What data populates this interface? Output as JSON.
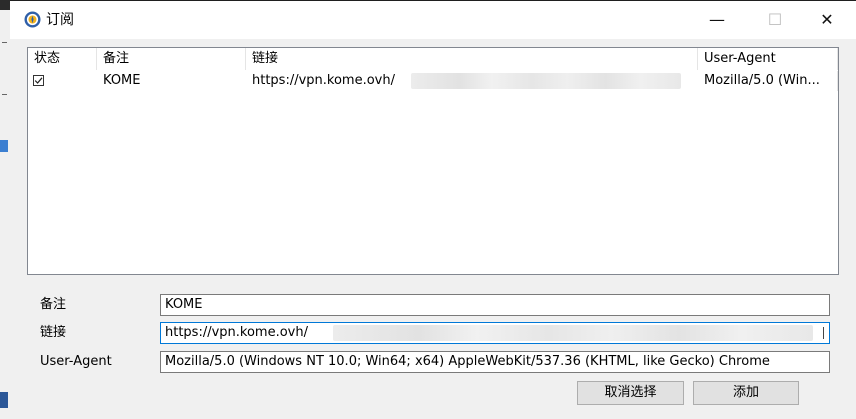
{
  "window": {
    "title": "订阅",
    "icon": "app-badge-icon",
    "controls": {
      "minimize": "—",
      "maximize": "☐",
      "close": "✕"
    }
  },
  "list": {
    "columns": [
      "状态",
      "备注",
      "链接",
      "User-Agent"
    ],
    "rows": [
      {
        "checked": true,
        "remark": "KOME",
        "link": "https://vpn.kome.ovh/",
        "user_agent": "Mozilla/5.0 (Win..."
      }
    ]
  },
  "form": {
    "remark_label": "备注",
    "remark_value": "KOME",
    "link_label": "链接",
    "link_value": "https://vpn.kome.ovh/",
    "ua_label": "User-Agent",
    "ua_value": "Mozilla/5.0 (Windows NT 10.0; Win64; x64) AppleWebKit/537.36 (KHTML, like Gecko) Chrome"
  },
  "buttons": {
    "cancel_selection": "取消选择",
    "add": "添加"
  },
  "colors": {
    "dialog_bg": "#f0f0f0",
    "focus_border": "#0078d7",
    "icon_ring": "#2f5fa8",
    "icon_center": "#f2b21b"
  }
}
